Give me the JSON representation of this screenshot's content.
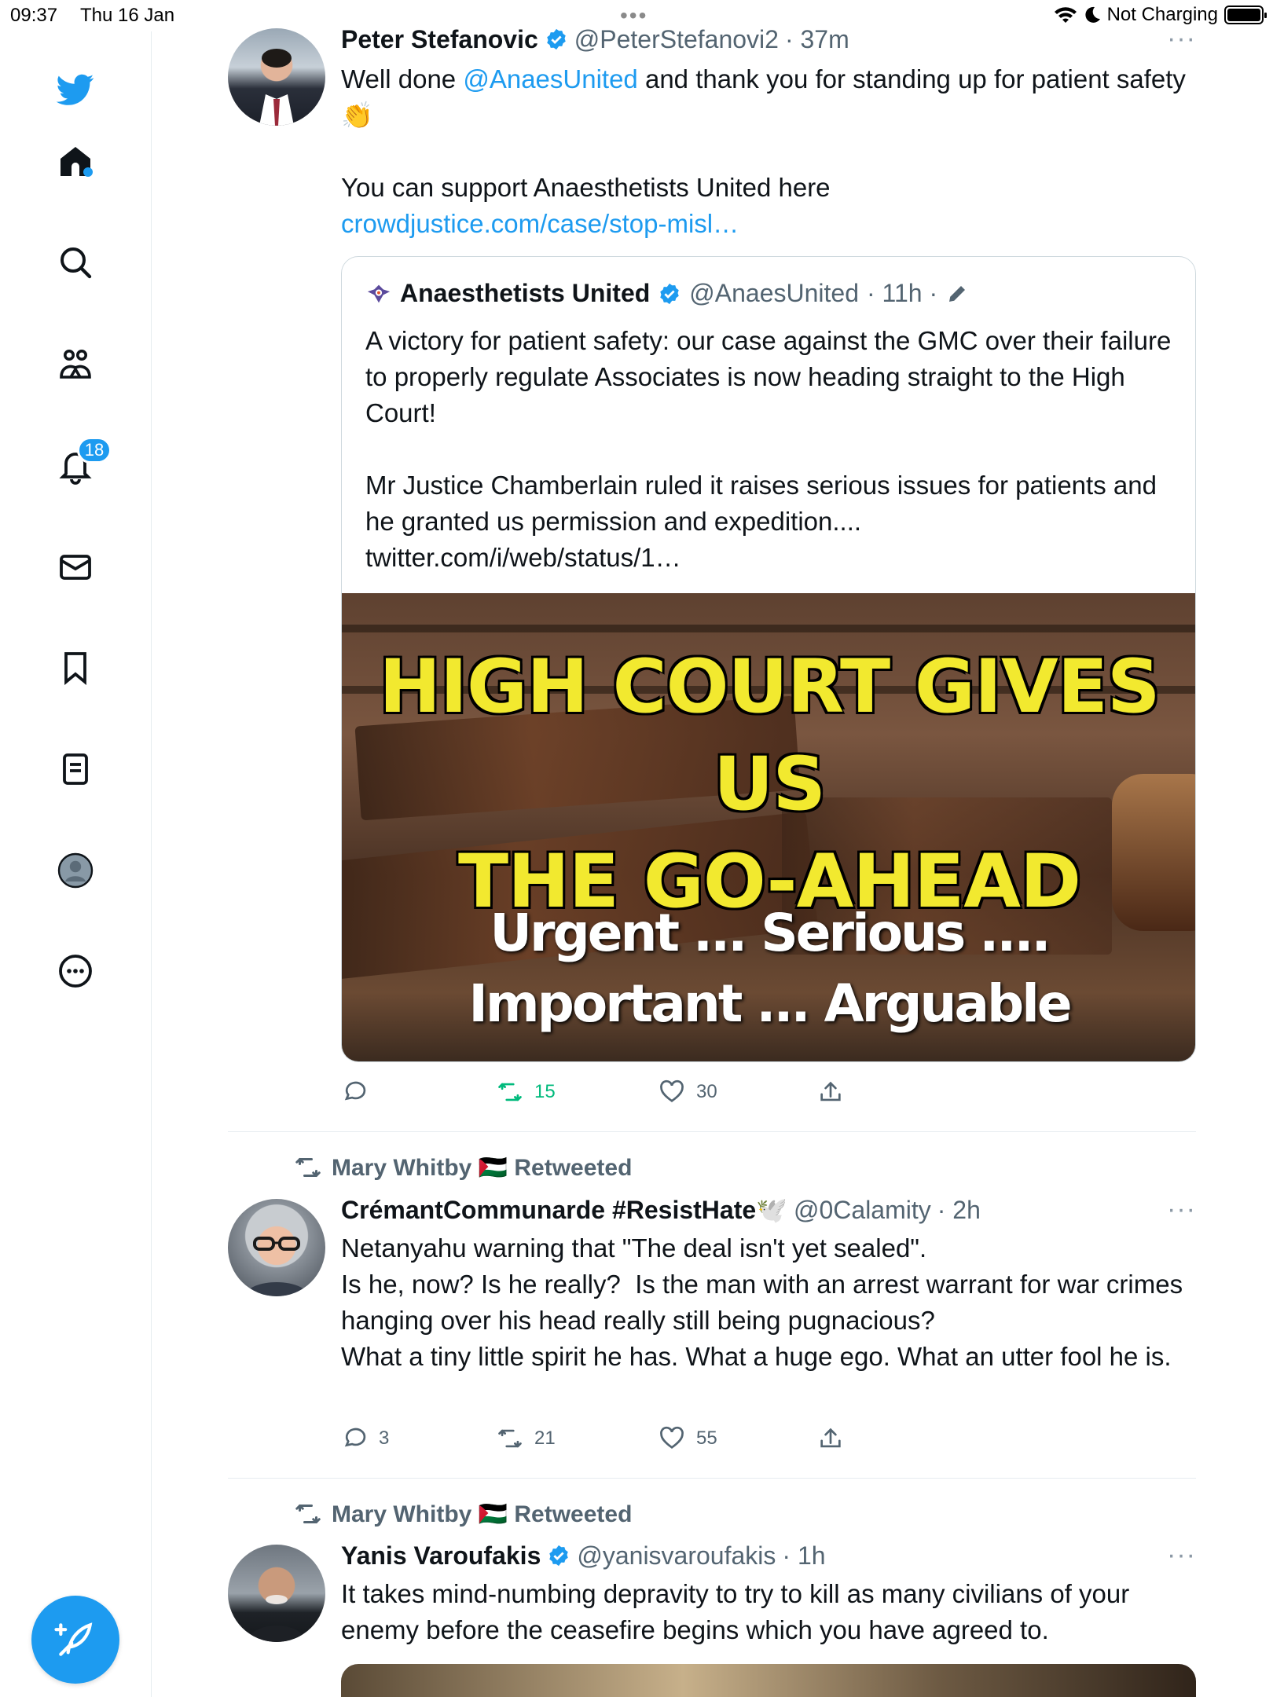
{
  "status_bar": {
    "time": "09:37",
    "date": "Thu 16 Jan",
    "charging": "Not Charging"
  },
  "sidebar": {
    "items": [
      "home",
      "search",
      "communities",
      "notifications",
      "messages",
      "bookmarks",
      "lists",
      "profile",
      "more"
    ],
    "notifications_count": "18"
  },
  "tweets": [
    {
      "name": "Peter Stefanovic",
      "handle": "@PeterStefanovi2",
      "time": "· 37m",
      "text_pre": "Well done ",
      "mention": "@AnaesUnited",
      "text_post": " and thank you for standing up for patient safety👏\n\nYou can support Anaesthetists United here",
      "link": "crowdjustice.com/case/stop-misl…",
      "more": "···",
      "quote": {
        "name": "Anaesthetists United",
        "handle": "@AnaesUnited",
        "time": "· 11h ·",
        "text": "A victory for patient safety: our case against the GMC over their failure to properly regulate Associates is now heading straight to the High Court!\n\nMr Justice Chamberlain ruled it raises serious issues for patients and he granted us permission and expedition.... twitter.com/i/web/status/1…",
        "image_headline_1": "HIGH COURT GIVES US",
        "image_headline_2": "THE GO-AHEAD",
        "image_sub_1": "Urgent ... Serious ....",
        "image_sub_2": "Important ... Arguable"
      },
      "reply_count": "",
      "retweet_count": "15",
      "like_count": "30"
    },
    {
      "retweeted_by": "Mary Whitby 🇵🇸 Retweeted",
      "name": "CrémantCommunarde #ResistHate🕊️",
      "handle": "@0Calamity",
      "time": "· 2h",
      "text": "Netanyahu warning that \"The deal isn't yet sealed\".\nIs he, now? Is he really?  Is the man with an arrest warrant for war crimes hanging over his head really still being pugnacious?\nWhat a tiny little spirit he has. What a huge ego. What an utter fool he is.",
      "more": "···",
      "reply_count": "3",
      "retweet_count": "21",
      "like_count": "55"
    },
    {
      "retweeted_by": "Mary Whitby 🇵🇸 Retweeted",
      "name": "Yanis Varoufakis",
      "handle": "@yanisvaroufakis",
      "time": "· 1h",
      "text": "It takes mind-numbing depravity to try to kill as many civilians of your enemy before the ceasefire begins which you have agreed to.",
      "more": "···"
    }
  ],
  "colors": {
    "accent": "#1d9bf0",
    "retweet_active": "#00ba7c",
    "secondary_text": "#536471"
  }
}
